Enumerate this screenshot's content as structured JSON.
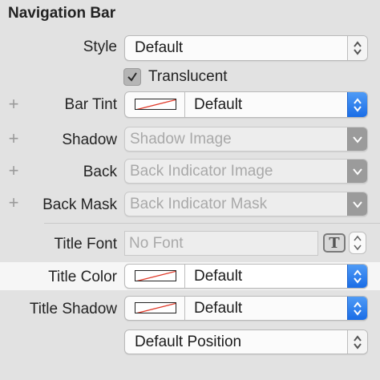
{
  "section": {
    "title": "Navigation Bar"
  },
  "style_row": {
    "label": "Style",
    "value": "Default"
  },
  "translucent": {
    "label": "Translucent",
    "checked": true
  },
  "bar_tint": {
    "label": "Bar Tint",
    "value": "Default"
  },
  "shadow": {
    "label": "Shadow",
    "placeholder": "Shadow Image"
  },
  "back": {
    "label": "Back",
    "placeholder": "Back Indicator Image"
  },
  "back_mask": {
    "label": "Back Mask",
    "placeholder": "Back Indicator Mask"
  },
  "title_font": {
    "label": "Title Font",
    "placeholder": "No Font",
    "font_button": "T"
  },
  "title_color": {
    "label": "Title Color",
    "value": "Default"
  },
  "title_shadow": {
    "label": "Title Shadow",
    "value": "Default"
  },
  "position": {
    "value": "Default Position"
  },
  "plus_symbol": "+",
  "colors": {
    "accent": "#1a6de6",
    "background": "#e2e2e2",
    "highlight": "#f6f6f6"
  }
}
